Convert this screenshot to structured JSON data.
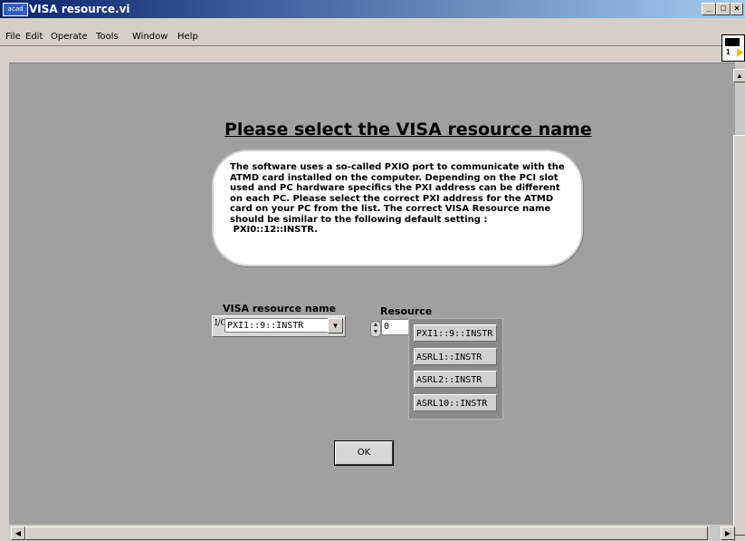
{
  "window": {
    "title": "VISA resource.vi",
    "app_icon_text": "acad"
  },
  "menu": [
    "File",
    "Edit",
    "Operate",
    "Tools",
    "Window",
    "Help"
  ],
  "toolbar": {
    "vi_icon_number": "1"
  },
  "panel": {
    "heading": "Please select the VISA resource name",
    "info_text": "The software uses a so-called PXIO port to communicate with the ATMD card installed on the computer. Depending on the PCI slot used and PC hardware specifics the PXI address can be different on each PC. Please select the correct PXI address for the ATMD card on your PC from the list. The correct VISA Resource name should be similar to the following default setting :\n PXI0::12::INSTR.",
    "visa_label": "VISA resource name",
    "visa_io_glyph": "I/O",
    "visa_value": "PXI1::9::INSTR",
    "resource_label": "Resource",
    "resource_index": "0",
    "resources": [
      "PXI1::9::INSTR",
      "ASRL1::INSTR",
      "ASRL2::INSTR",
      "ASRL10::INSTR"
    ],
    "ok_label": "OK"
  }
}
